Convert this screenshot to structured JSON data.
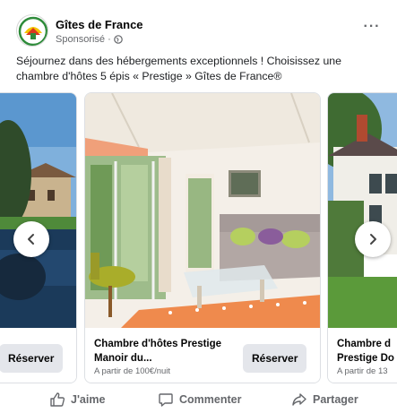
{
  "header": {
    "page_name": "Gîtes de France",
    "sponsored_label": "Sponsorisé ·",
    "more_label": "···"
  },
  "post": {
    "text": "Séjournez dans des hébergements exceptionnels ! Choisissez  une chambre d'hôtes 5 épis « Prestige » Gîtes de France®"
  },
  "carousel": {
    "cards": [
      {
        "cta": "Réserver"
      },
      {
        "title": "Chambre d'hôtes Prestige Manoir du...",
        "price": "A partir de 100€/nuit",
        "cta": "Réserver"
      },
      {
        "title": "Chambre d Prestige Do",
        "price": "A partir de 13"
      }
    ]
  },
  "actions": {
    "like": "J'aime",
    "comment": "Commenter",
    "share": "Partager"
  },
  "colors": {
    "text_primary": "#050505",
    "text_secondary": "#65676b",
    "button_bg": "#e4e6eb",
    "brand_green": "#2e8b3a",
    "brand_yellow": "#f5c400"
  }
}
